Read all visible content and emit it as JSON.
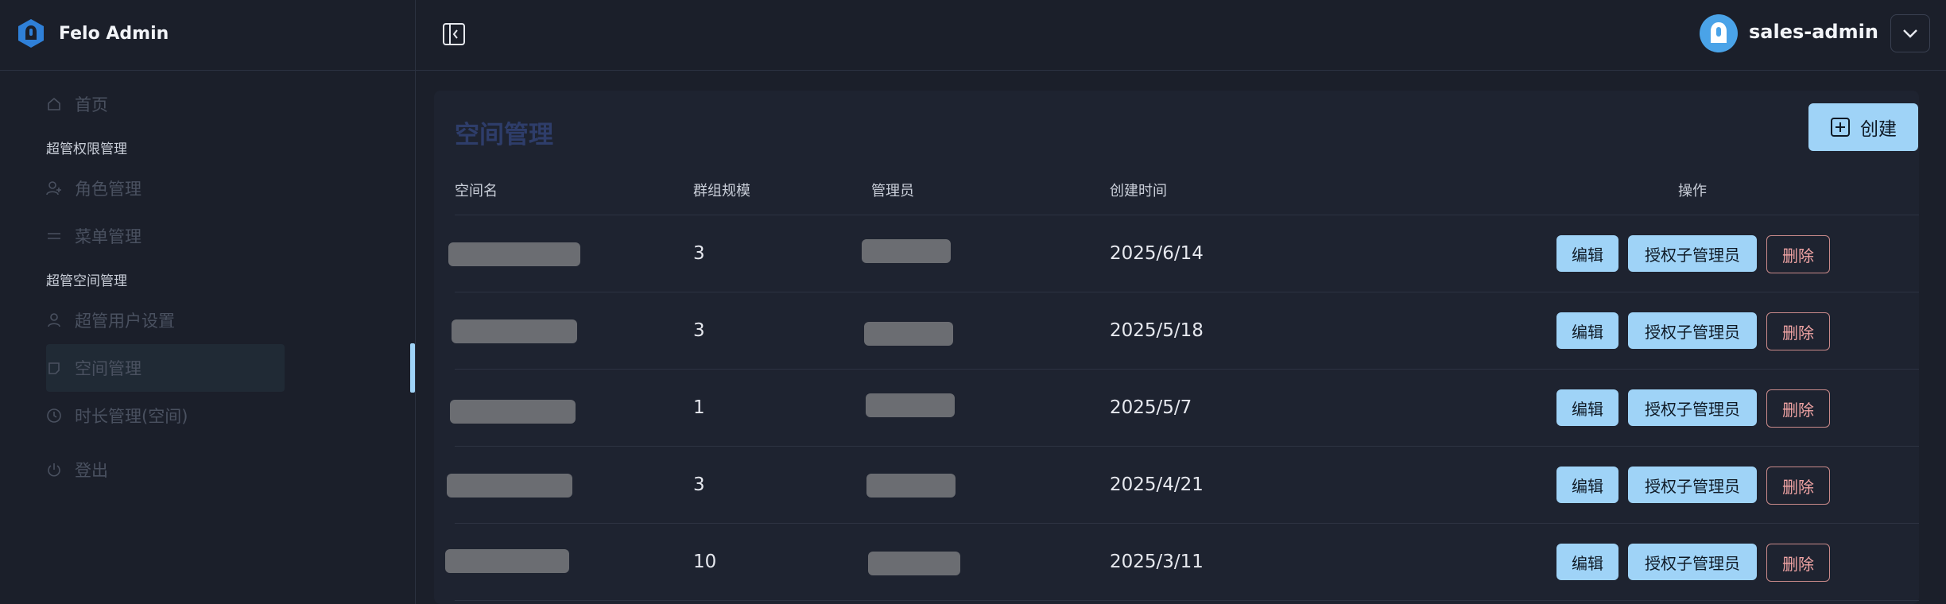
{
  "app": {
    "title": "Felo Admin"
  },
  "sidebar": {
    "home": "首页",
    "group1": "超管权限管理",
    "role_mgmt": "角色管理",
    "menu_mgmt": "菜单管理",
    "group2": "超管空间管理",
    "user_settings": "超管用户设置",
    "space_mgmt": "空间管理",
    "duration_mgmt": "时长管理(空间)",
    "logout": "登出"
  },
  "header": {
    "username": "sales-admin"
  },
  "main": {
    "title": "空间管理",
    "create_label": "创建",
    "columns": [
      "空间名",
      "群组规模",
      "管理员",
      "创建时间",
      "操作"
    ],
    "actions": {
      "edit": "编辑",
      "authorize": "授权子管理员",
      "delete": "删除"
    },
    "rows": [
      {
        "group_size": "3",
        "created": "2025/6/14"
      },
      {
        "group_size": "3",
        "created": "2025/5/18"
      },
      {
        "group_size": "1",
        "created": "2025/5/7"
      },
      {
        "group_size": "3",
        "created": "2025/4/21"
      },
      {
        "group_size": "10",
        "created": "2025/3/11"
      }
    ]
  },
  "colors": {
    "accent": "#9fd3f7",
    "danger": "#f2a5a5",
    "background": "#1b1f2a"
  }
}
